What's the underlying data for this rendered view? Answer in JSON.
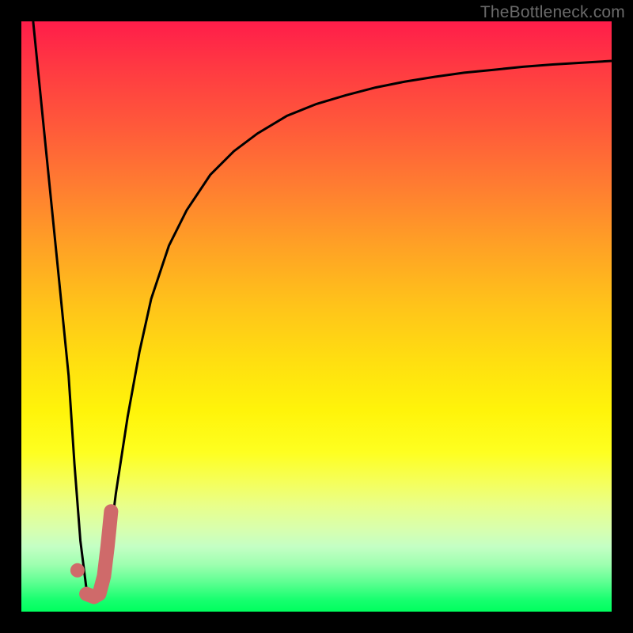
{
  "watermark": {
    "text": "TheBottleneck.com"
  },
  "chart_data": {
    "type": "line",
    "title": "",
    "xlabel": "",
    "ylabel": "",
    "xlim": [
      0,
      100
    ],
    "ylim": [
      0,
      100
    ],
    "background_gradient": {
      "orientation": "vertical",
      "stops": [
        {
          "pos": 0.0,
          "color": "#ff1d4a"
        },
        {
          "pos": 0.5,
          "color": "#ffd015"
        },
        {
          "pos": 0.8,
          "color": "#f8ff50"
        },
        {
          "pos": 1.0,
          "color": "#00ff5e"
        }
      ]
    },
    "series": [
      {
        "name": "bottleneck-curve",
        "stroke": "#000000",
        "stroke_width": 3,
        "x": [
          2,
          4,
          6,
          8,
          9,
          10,
          11,
          12,
          13,
          14,
          15,
          16,
          18,
          20,
          22,
          25,
          28,
          32,
          36,
          40,
          45,
          50,
          55,
          60,
          65,
          70,
          75,
          80,
          85,
          90,
          95,
          100
        ],
        "y": [
          100,
          80,
          60,
          40,
          25,
          12,
          4,
          2,
          3,
          6,
          12,
          20,
          33,
          44,
          53,
          62,
          68,
          74,
          78,
          81,
          84,
          86,
          87.5,
          88.8,
          89.8,
          90.6,
          91.3,
          91.8,
          92.3,
          92.7,
          93.0,
          93.3
        ]
      },
      {
        "name": "marker-dot",
        "type": "scatter",
        "color": "#cf6a6a",
        "x": [
          9.5
        ],
        "y": [
          7
        ]
      },
      {
        "name": "marker-hook",
        "stroke": "#cf6a6a",
        "stroke_width": 18,
        "stroke_linecap": "round",
        "x": [
          11,
          12.3,
          13.2,
          14,
          14.6,
          15.2
        ],
        "y": [
          3,
          2.5,
          3,
          6,
          11,
          17
        ]
      }
    ]
  }
}
